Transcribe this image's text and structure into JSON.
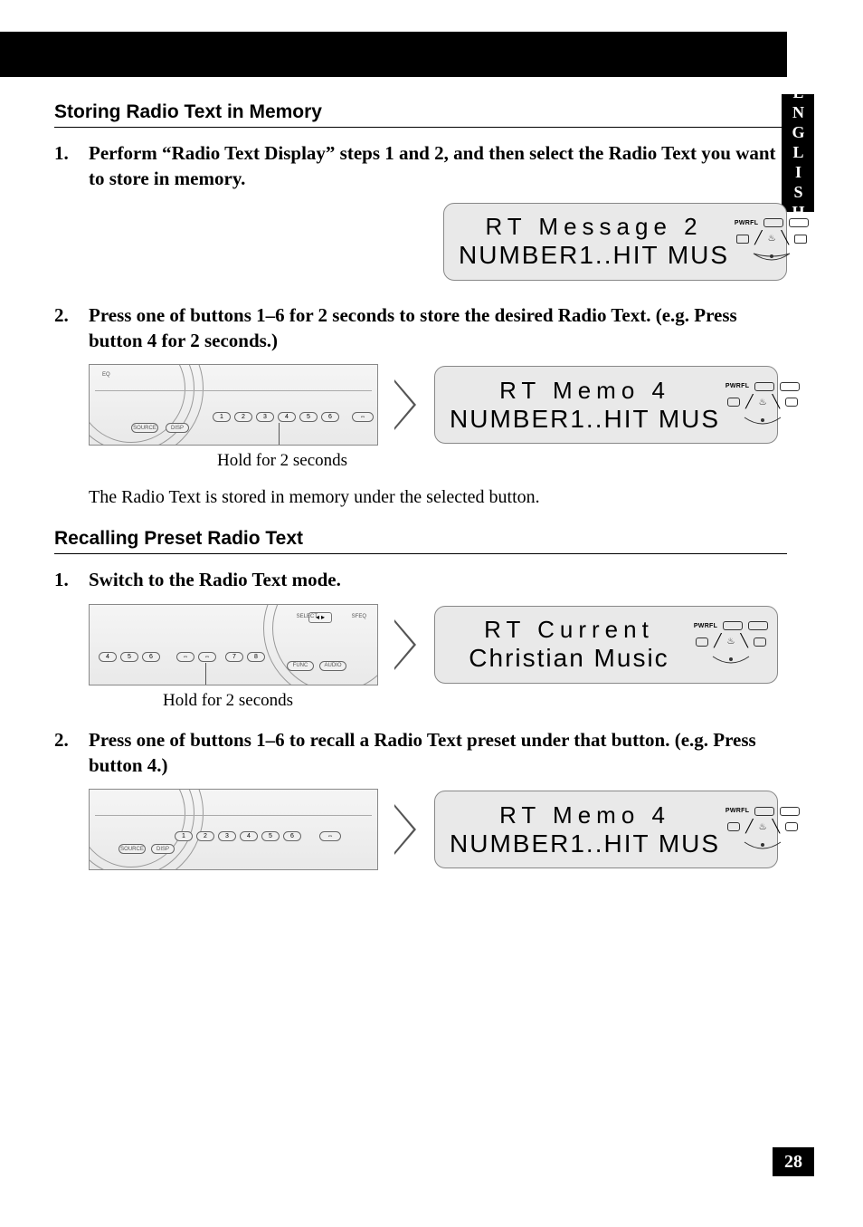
{
  "side_tab": "ENGLISH",
  "page_number": "28",
  "section1": {
    "heading": "Storing Radio Text in Memory",
    "step1_num": "1.",
    "step1_text": "Perform “Radio Text Display” steps 1 and 2, and then select the Radio Text you want to store in memory.",
    "lcd1": {
      "line1": "RT Message 2",
      "line2": "NUMBER1..HIT MUS",
      "pwr": "PWRFL"
    },
    "step2_num": "2.",
    "step2_text": "Press one of buttons 1–6 for 2 seconds to store the desired Radio Text. (e.g. Press button 4 for 2 seconds.)",
    "caption": "Hold for 2 seconds",
    "lcd2": {
      "line1": "RT Memo 4",
      "line2": "NUMBER1..HIT MUS",
      "pwr": "PWRFL"
    },
    "note": "The Radio Text is stored in memory under the selected button."
  },
  "section2": {
    "heading": "Recalling Preset Radio Text",
    "step1_num": "1.",
    "step1_text": "Switch to the Radio Text mode.",
    "caption": "Hold for 2 seconds",
    "lcd1": {
      "line1": "RT Current",
      "line2": "Christian Music",
      "pwr": "PWRFL"
    },
    "step2_num": "2.",
    "step2_text": "Press one of buttons 1–6 to recall a Radio Text preset under that button. (e.g. Press button 4.)",
    "lcd2": {
      "line1": "RT Memo 4",
      "line2": "NUMBER1..HIT MUS",
      "pwr": "PWRFL"
    }
  },
  "device": {
    "buttons": [
      "1",
      "2",
      "3",
      "4",
      "5",
      "6"
    ],
    "buttons_b": [
      "4",
      "5",
      "6",
      "7",
      "8"
    ],
    "source": "SOURCE",
    "disp": "DISP",
    "func": "FUNC",
    "audio": "AUDIO",
    "eq": "EQ",
    "select": "SELECT",
    "sfeq": "SFEQ"
  }
}
